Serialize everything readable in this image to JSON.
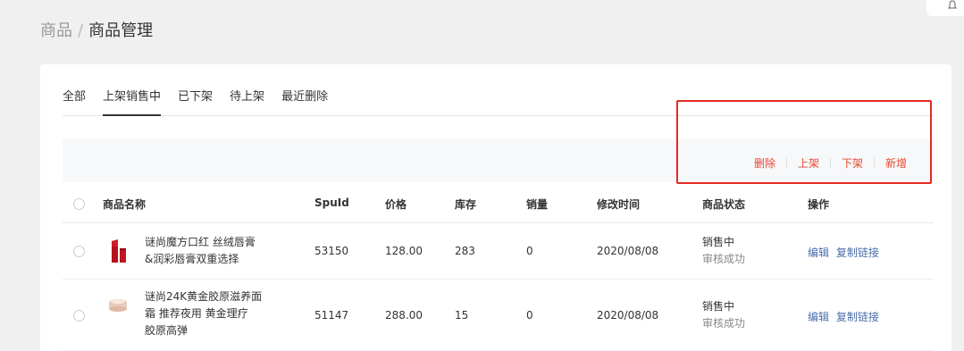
{
  "breadcrumb": {
    "parent": "商品",
    "separator": "/",
    "current": "商品管理"
  },
  "tabs": [
    {
      "label": "全部",
      "active": false
    },
    {
      "label": "上架销售中",
      "active": true
    },
    {
      "label": "已下架",
      "active": false
    },
    {
      "label": "待上架",
      "active": false
    },
    {
      "label": "最近删除",
      "active": false
    }
  ],
  "actions": {
    "delete": "删除",
    "on_shelf": "上架",
    "off_shelf": "下架",
    "add": "新增"
  },
  "table": {
    "headers": {
      "name": "商品名称",
      "spuid": "SpuId",
      "price": "价格",
      "stock": "库存",
      "sales": "销量",
      "modified": "修改时间",
      "status": "商品状态",
      "ops": "操作"
    },
    "rows": [
      {
        "name_line1": "谜尚魔方口红 丝绒唇膏",
        "name_line2": "&润彩唇膏双重选择",
        "name_line3": "",
        "thumb": "lipstick-thumbnail",
        "spuid": "53150",
        "price": "128.00",
        "stock": "283",
        "sales": "0",
        "modified": "2020/08/08",
        "status_main": "销售中",
        "status_sub": "审核成功",
        "op_edit": "编辑",
        "op_copy": "复制链接"
      },
      {
        "name_line1": "谜尚24K黄金胶原滋养面",
        "name_line2": "霜 推荐夜用 黄金理疗",
        "name_line3": "胶原高弹",
        "thumb": "cream-jar-thumbnail",
        "spuid": "51147",
        "price": "288.00",
        "stock": "15",
        "sales": "0",
        "modified": "2020/08/08",
        "status_main": "销售中",
        "status_sub": "审核成功",
        "op_edit": "编辑",
        "op_copy": "复制链接"
      }
    ]
  },
  "colors": {
    "accent": "#e8472e",
    "link": "#4a6ea9",
    "highlight": "#e52a20"
  }
}
